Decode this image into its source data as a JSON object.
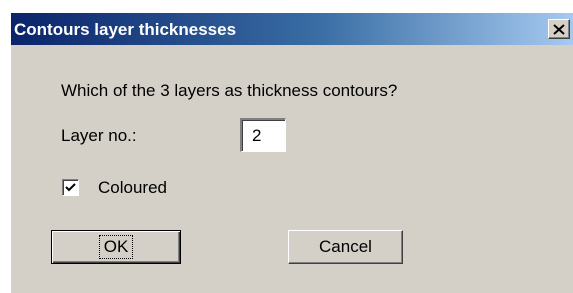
{
  "window": {
    "title": "Contours layer thicknesses",
    "close_glyph": "X",
    "close_icon": "close-icon"
  },
  "form": {
    "prompt": "Which of the 3 layers as thickness contours?",
    "layer_label": "Layer no.:",
    "layer_value": "2",
    "coloured_label": "Coloured",
    "coloured_checked": true
  },
  "buttons": {
    "ok_label": "OK",
    "cancel_label": "Cancel"
  },
  "colors": {
    "titlebar_start": "#0a246a",
    "titlebar_end": "#a6caf0",
    "dialog_face": "#d4d0c8"
  }
}
